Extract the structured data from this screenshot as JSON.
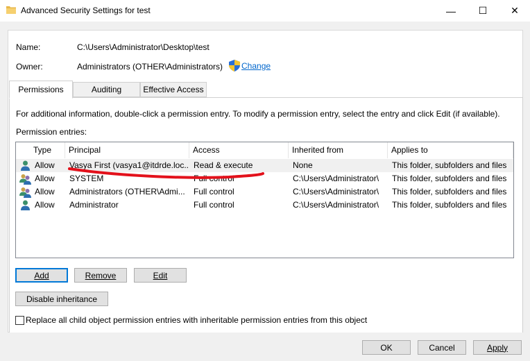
{
  "window": {
    "title": "Advanced Security Settings for test",
    "min_glyph": "—",
    "max_glyph": "☐",
    "close_glyph": "✕"
  },
  "info": {
    "name_label": "Name:",
    "name_value": "C:\\Users\\Administrator\\Desktop\\test",
    "owner_label": "Owner:",
    "owner_value": "Administrators (OTHER\\Administrators)",
    "change_link": "Change"
  },
  "tabs": [
    {
      "label": "Permissions",
      "active": true
    },
    {
      "label": "Auditing",
      "active": false
    },
    {
      "label": "Effective Access",
      "active": false
    }
  ],
  "permissions": {
    "info_text": "For additional information, double-click a permission entry. To modify a permission entry, select the entry and click Edit (if available).",
    "entries_label": "Permission entries:",
    "columns": [
      "Type",
      "Principal",
      "Access",
      "Inherited from",
      "Applies to"
    ],
    "rows": [
      {
        "icon": "user-icon",
        "type": "Allow",
        "principal": "Vasya First (vasya1@itdrde.loc...",
        "access": "Read & execute",
        "inherited_from": "None",
        "applies_to": "This folder, subfolders and files",
        "selected": true
      },
      {
        "icon": "group-icon",
        "type": "Allow",
        "principal": "SYSTEM",
        "access": "Full control",
        "inherited_from": "C:\\Users\\Administrator\\",
        "applies_to": "This folder, subfolders and files",
        "selected": false
      },
      {
        "icon": "group-icon",
        "type": "Allow",
        "principal": "Administrators (OTHER\\Admi...",
        "access": "Full control",
        "inherited_from": "C:\\Users\\Administrator\\",
        "applies_to": "This folder, subfolders and files",
        "selected": false
      },
      {
        "icon": "user-icon",
        "type": "Allow",
        "principal": "Administrator",
        "access": "Full control",
        "inherited_from": "C:\\Users\\Administrator\\",
        "applies_to": "This folder, subfolders and files",
        "selected": false
      }
    ]
  },
  "buttons": {
    "add": "Add",
    "remove": "Remove",
    "edit": "Edit",
    "disable_inheritance": "Disable inheritance",
    "replace_checkbox_label": "Replace all child object permission entries with inheritable permission entries from this object",
    "ok": "OK",
    "cancel": "Cancel",
    "apply": "Apply"
  },
  "colors": {
    "link": "#0066cc",
    "annotation_red": "#e3111b",
    "default_button_border": "#0078d7"
  }
}
